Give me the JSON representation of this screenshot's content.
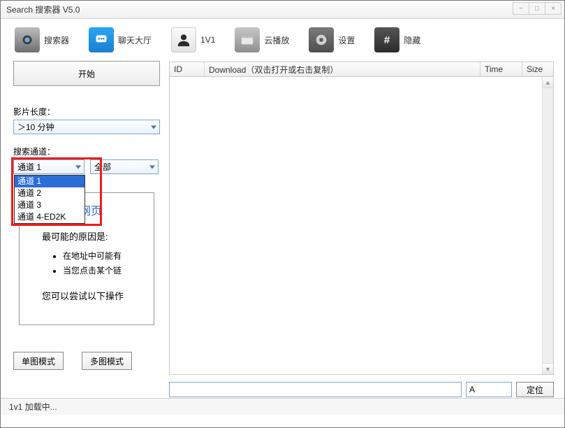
{
  "window": {
    "title": "Search 搜索器 V5.0"
  },
  "toolbar": {
    "searcher": "搜索器",
    "chat": "聊天大厅",
    "one_v_one": "1V1",
    "cloud_play": "云播放",
    "settings": "设置",
    "hide": "隐藏"
  },
  "left": {
    "start": "开始",
    "duration_label": "影片长度：",
    "duration_value": "＞10 分钟",
    "channel_label": "搜索通道：",
    "channel_value": "通道 1",
    "filter_value": "全部",
    "channel_options": [
      "通道 1",
      "通道 2",
      "通道 3",
      "通道 4-ED2K"
    ],
    "info": {
      "title": "戈到该网页",
      "reason_heading": "最可能的原因是:",
      "bullets": [
        "在地址中可能有",
        "当您点击某个链"
      ],
      "try_heading": "您可以尝试以下操作"
    },
    "mode_single": "单图模式",
    "mode_multi": "多图模式"
  },
  "table": {
    "col_id": "ID",
    "col_download": "Download（双击打开或右击复制）",
    "col_time": "Time",
    "col_size": "Size"
  },
  "bottom": {
    "long_value": "",
    "short_value": "A",
    "locate": "定位"
  },
  "status": "1v1 加载中..."
}
